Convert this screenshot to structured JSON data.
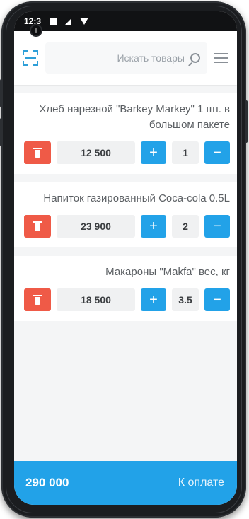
{
  "status": {
    "time": "12:3"
  },
  "header": {
    "search_placeholder": "Искать товары"
  },
  "items": [
    {
      "title": "Хлеб нарезной \"Barkey Markey\" 1 шт. в большом пакете",
      "qty": "1",
      "price": "12 500",
      "plus": "+",
      "minus": "−"
    },
    {
      "title": "Напиток газированный Coca-cola 0.5L",
      "qty": "2",
      "price": "23 900",
      "plus": "+",
      "minus": "−"
    },
    {
      "title": "Макароны \"Makfa\" вес, кг",
      "qty": "3.5",
      "price": "18 500",
      "plus": "+",
      "minus": "−"
    }
  ],
  "footer": {
    "total": "290 000",
    "pay_label": "К оплате"
  },
  "colors": {
    "accent": "#22a2e8",
    "danger": "#ef5a47"
  }
}
